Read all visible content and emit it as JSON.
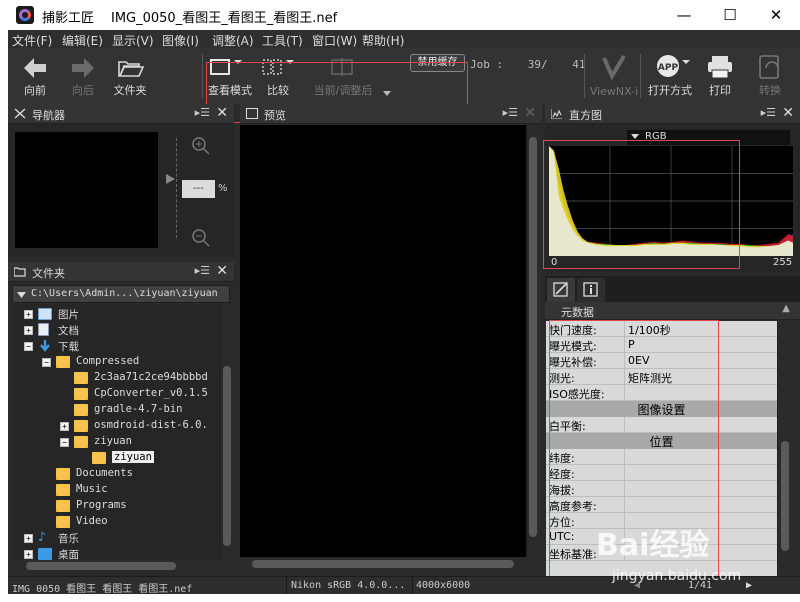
{
  "window": {
    "app_name": "捕影工匠",
    "file_title": "IMG_0050_看图王_看图王_看图王.nef",
    "min_glyph": "—",
    "max_glyph": "☐",
    "close_glyph": "✕"
  },
  "menu": [
    "文件(F)",
    "编辑(E)",
    "显示(V)",
    "图像(I)",
    "调整(A)",
    "工具(T)",
    "窗口(W)",
    "帮助(H)"
  ],
  "toolbar": {
    "back": "向前",
    "forward": "向后",
    "folder": "文件夹",
    "view_mode": "查看模式",
    "compare": "比较",
    "current_adjusted": "当前/调整后",
    "disable_cache": "禁用缓存",
    "job_label": "Job :",
    "job_current": "39/",
    "job_total": "41",
    "viewnx": "ViewNX-i",
    "open_with": "打开方式",
    "print": "打印",
    "convert": "转换"
  },
  "navigator": {
    "title": "导航器",
    "zoom_value": "---",
    "zoom_unit": "%"
  },
  "preview": {
    "title": "预览"
  },
  "histogram": {
    "title": "直方图",
    "channel": "RGB"
  },
  "chart_data": {
    "type": "area",
    "title": "",
    "xlabel": "",
    "ylabel": "",
    "x_tick_labels": [
      "0",
      "255"
    ],
    "xlim": [
      0,
      255
    ],
    "ylim": [
      0,
      100
    ],
    "x": [
      0,
      5,
      10,
      15,
      20,
      25,
      30,
      35,
      40,
      50,
      60,
      70,
      80,
      90,
      100,
      110,
      120,
      130,
      140,
      150,
      160,
      170,
      180,
      190,
      200,
      210,
      220,
      230,
      240,
      245,
      250,
      255
    ],
    "series": [
      {
        "name": "",
        "color": "#1e3fd8",
        "values": [
          100,
          92,
          45,
          40,
          30,
          22,
          17,
          14,
          12,
          11,
          10,
          9,
          9,
          9,
          10,
          10,
          10,
          11,
          11,
          11,
          10,
          10,
          10,
          10,
          9,
          9,
          8,
          9,
          10,
          14,
          18,
          20
        ]
      },
      {
        "name": "",
        "color": "#e32020",
        "values": [
          100,
          95,
          68,
          50,
          38,
          28,
          20,
          16,
          13,
          12,
          11,
          10,
          10,
          11,
          12,
          13,
          12,
          13,
          14,
          13,
          12,
          12,
          12,
          11,
          11,
          10,
          10,
          11,
          12,
          16,
          20,
          18
        ]
      },
      {
        "name": "",
        "color": "#1fae3a",
        "values": [
          100,
          95,
          62,
          46,
          34,
          25,
          18,
          15,
          12,
          11,
          11,
          10,
          10,
          10,
          11,
          12,
          11,
          12,
          12,
          12,
          11,
          11,
          11,
          10,
          10,
          10,
          9,
          9,
          10,
          12,
          14,
          12
        ]
      },
      {
        "name": "",
        "color": "#f2e22a",
        "values": [
          100,
          96,
          80,
          60,
          45,
          32,
          22,
          16,
          13,
          11,
          10,
          10,
          10,
          10,
          11,
          11,
          11,
          12,
          12,
          11,
          11,
          11,
          10,
          10,
          10,
          9,
          9,
          9,
          10,
          12,
          14,
          12
        ]
      },
      {
        "name": "",
        "color": "#eaeaea",
        "values": [
          100,
          94,
          55,
          42,
          32,
          24,
          18,
          14,
          12,
          10,
          9,
          9,
          9,
          9,
          10,
          10,
          10,
          11,
          11,
          10,
          10,
          10,
          10,
          9,
          9,
          8,
          8,
          9,
          10,
          12,
          14,
          12
        ]
      }
    ]
  },
  "folders": {
    "title": "文件夹",
    "path": "C:\\Users\\Admin...\\ziyuan\\ziyuan",
    "tree": [
      {
        "label": "图片",
        "type": "pictures",
        "level": 0,
        "exp": "+"
      },
      {
        "label": "文档",
        "type": "documents",
        "level": 0,
        "exp": "+"
      },
      {
        "label": "下载",
        "type": "downloads",
        "level": 0,
        "exp": "−"
      },
      {
        "label": "Compressed",
        "type": "folder",
        "level": 1,
        "exp": "−"
      },
      {
        "label": "2c3aa71c2ce94bbbbd",
        "type": "folder",
        "level": 2,
        "exp": ""
      },
      {
        "label": "CpConverter_v0.1.5",
        "type": "folder",
        "level": 2,
        "exp": ""
      },
      {
        "label": "gradle-4.7-bin",
        "type": "folder",
        "level": 2,
        "exp": ""
      },
      {
        "label": "osmdroid-dist-6.0.",
        "type": "folder",
        "level": 2,
        "exp": "+"
      },
      {
        "label": "ziyuan",
        "type": "folder",
        "level": 2,
        "exp": "−"
      },
      {
        "label": "ziyuan",
        "type": "folder",
        "level": 3,
        "exp": "",
        "selected": true
      },
      {
        "label": "Documents",
        "type": "folder",
        "level": 1,
        "exp": ""
      },
      {
        "label": "Music",
        "type": "folder",
        "level": 1,
        "exp": ""
      },
      {
        "label": "Programs",
        "type": "folder",
        "level": 1,
        "exp": ""
      },
      {
        "label": "Video",
        "type": "folder",
        "level": 1,
        "exp": ""
      },
      {
        "label": "音乐",
        "type": "music",
        "level": 0,
        "exp": "+"
      },
      {
        "label": "桌面",
        "type": "desktop",
        "level": 0,
        "exp": "+"
      }
    ]
  },
  "metadata": {
    "title": "元数据",
    "rows": [
      {
        "kind": "row",
        "key": "快门速度:",
        "value": "1/100秒"
      },
      {
        "kind": "row",
        "key": "曝光模式:",
        "value": "P"
      },
      {
        "kind": "row",
        "key": "曝光补偿:",
        "value": "0EV"
      },
      {
        "kind": "row",
        "key": "测光:",
        "value": "矩阵测光"
      },
      {
        "kind": "row",
        "key": "ISO感光度:",
        "value": ""
      },
      {
        "kind": "section",
        "key": "图像设置"
      },
      {
        "kind": "row",
        "key": "白平衡:",
        "value": ""
      },
      {
        "kind": "section",
        "key": "位置"
      },
      {
        "kind": "row",
        "key": "纬度:",
        "value": ""
      },
      {
        "kind": "row",
        "key": "经度:",
        "value": ""
      },
      {
        "kind": "row",
        "key": "海拔:",
        "value": ""
      },
      {
        "kind": "row",
        "key": "高度参考:",
        "value": ""
      },
      {
        "kind": "row",
        "key": "方位:",
        "value": ""
      },
      {
        "kind": "row",
        "key": "UTC:",
        "value": ""
      },
      {
        "kind": "row",
        "key": "坐标基准:",
        "value": ""
      }
    ]
  },
  "status": {
    "filename": "IMG_0050_看图王_看图王_看图王.nef",
    "colorspace": "Nikon sRGB 4.0.0...",
    "dimensions": "4000x6000",
    "page": "1/41"
  },
  "watermark": {
    "text": "Bai经验",
    "url": "jingyan.baidu.com"
  },
  "colors": {
    "accent_red": "#e0464b",
    "folder": "#f5c24c",
    "selection": "#f0f0f0"
  }
}
